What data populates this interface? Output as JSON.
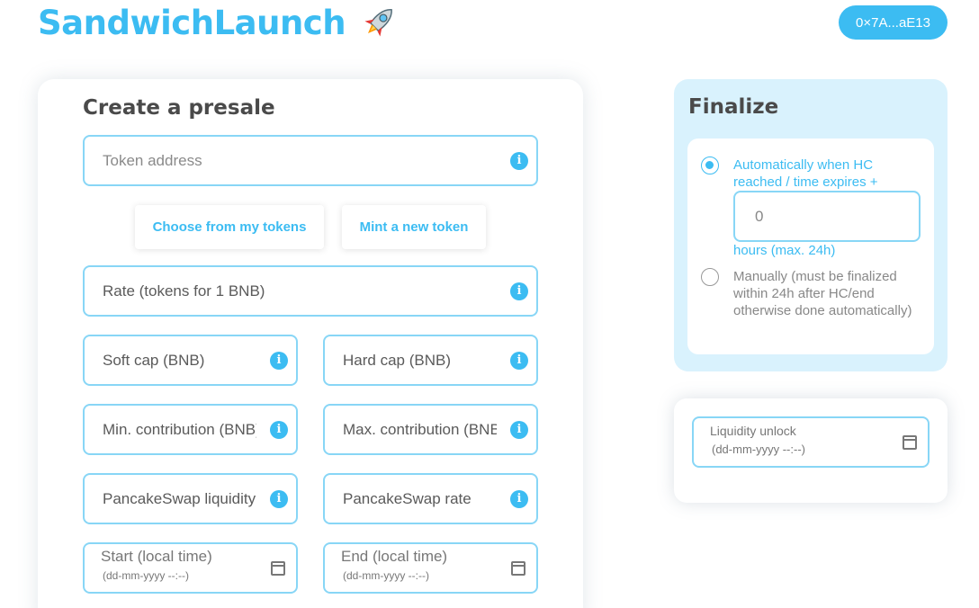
{
  "header": {
    "brand": "SandwichLaunch",
    "brand_icon": "rocket-icon",
    "wallet": "0×7A...aE13"
  },
  "colors": {
    "accent": "#3cbcf2",
    "border": "#88d6f6",
    "finalize_bg": "#d9f2fd"
  },
  "presale": {
    "title": "Create a presale",
    "token_address": "Token address",
    "choose_tokens": "Choose from my tokens",
    "mint_token": "Mint a new token",
    "rate": "Rate (tokens for 1 BNB)",
    "soft_cap": "Soft cap (BNB)",
    "hard_cap": "Hard cap (BNB)",
    "min_contribution": "Min. contribution (BNB)",
    "max_contribution": "Max. contribution (BNB)",
    "pancake_liquidity": "PancakeSwap liquidity (%)",
    "pancake_rate": "PancakeSwap rate",
    "start_label": "Start (local time)",
    "end_label": "End (local time)",
    "date_placeholder": "(dd-mm-yyyy --:--)"
  },
  "finalize": {
    "title": "Finalize",
    "auto_option": "Automatically when HC reached / time expires +",
    "hours_value": "0",
    "hours_note": "hours (max. 24h)",
    "manual_option": "Manually (must be finalized within 24h after HC/end otherwise done automatically)",
    "selected": "auto"
  },
  "unlock": {
    "label": "Liquidity unlock",
    "placeholder": "(dd-mm-yyyy --:--)"
  }
}
